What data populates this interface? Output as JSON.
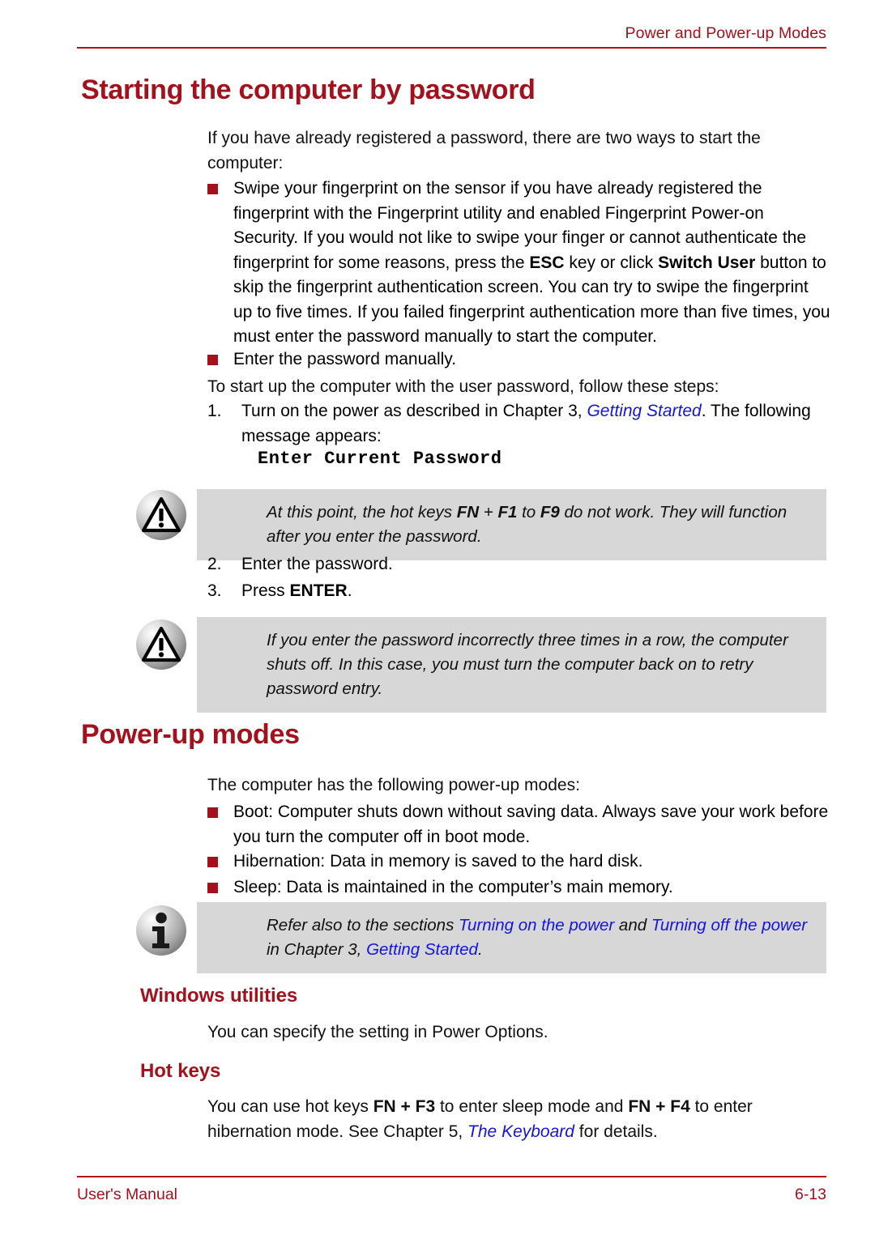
{
  "page": {
    "header_title": "Power and Power-up Modes",
    "footer_left": "User's Manual",
    "footer_right": "6-13",
    "accent_red": "#A4101B",
    "link_blue": "#1414E0",
    "note_bg": "#D7D7D7"
  },
  "sections": {
    "starting": {
      "heading": "Starting the computer by password",
      "intro": "If you have already registered a password, there are two ways to start the computer:",
      "bullets": [
        {
          "parts": [
            {
              "t": "Swipe your fingerprint on the sensor if you have already registered the fingerprint with the Fingerprint utility and enabled Fingerprint Power-on Security. If you would not like to swipe your finger or cannot authenticate the fingerprint for some reasons, press the ",
              "s": "normal"
            },
            {
              "t": "ESC",
              "s": "bold"
            },
            {
              "t": " key or click ",
              "s": "normal"
            },
            {
              "t": "Switch User",
              "s": "bold"
            },
            {
              "t": " button to skip the fingerprint authentication screen. You can try to swipe the fingerprint up to five times. If you failed fingerprint authentication more than five times, you must enter the password manually to start the computer.",
              "s": "normal"
            }
          ]
        },
        {
          "parts": [
            {
              "t": "Enter the password manually.",
              "s": "normal"
            }
          ]
        }
      ],
      "steps_intro": "To start up the computer with the user password, follow these steps:",
      "steps": [
        {
          "num": "1.",
          "parts": [
            {
              "t": "Turn on the power as described in Chapter 3, ",
              "s": "normal"
            },
            {
              "t": "Getting Started",
              "s": "link-italic"
            },
            {
              "t": ". The following message appears:",
              "s": "normal"
            }
          ]
        },
        {
          "num": "2.",
          "parts": [
            {
              "t": "Enter the password.",
              "s": "normal"
            }
          ]
        },
        {
          "num": "3.",
          "parts": [
            {
              "t": "Press ",
              "s": "normal"
            },
            {
              "t": "ENTER",
              "s": "bold"
            },
            {
              "t": ".",
              "s": "normal"
            }
          ]
        }
      ],
      "message_code": "Enter Current Password",
      "note_1": {
        "icon": "caution-icon",
        "parts": [
          {
            "t": "At this point, the hot keys ",
            "s": "italic"
          },
          {
            "t": "FN",
            "s": "bold-italic"
          },
          {
            "t": " + ",
            "s": "italic"
          },
          {
            "t": "F1",
            "s": "bold-italic"
          },
          {
            "t": " to ",
            "s": "italic"
          },
          {
            "t": "F9",
            "s": "bold-italic"
          },
          {
            "t": " do not work. They will function after you enter the password.",
            "s": "italic"
          }
        ]
      },
      "note_2": {
        "icon": "caution-icon",
        "parts": [
          {
            "t": "If you enter the password incorrectly three times in a row, the computer shuts off. In this case, you must turn the computer back on to retry password entry.",
            "s": "italic"
          }
        ]
      }
    },
    "powerup": {
      "heading": "Power-up modes",
      "intro": "The computer has the following power-up modes:",
      "bullets": [
        {
          "parts": [
            {
              "t": "Boot: Computer shuts down without saving data. Always save your work before you turn the computer off in boot mode.",
              "s": "normal"
            }
          ]
        },
        {
          "parts": [
            {
              "t": "Hibernation: Data in memory is saved to the hard disk.",
              "s": "normal"
            }
          ]
        },
        {
          "parts": [
            {
              "t": "Sleep: Data is maintained in the computer’s main memory.",
              "s": "normal"
            }
          ]
        }
      ],
      "note_3": {
        "icon": "info-icon",
        "parts": [
          {
            "t": "Refer also to the sections ",
            "s": "italic"
          },
          {
            "t": "Turning on the power",
            "s": "link-italic"
          },
          {
            "t": " and ",
            "s": "italic"
          },
          {
            "t": "Turning off the power",
            "s": "link-italic"
          },
          {
            "t": " in Chapter 3, ",
            "s": "italic"
          },
          {
            "t": "Getting Started",
            "s": "link-italic"
          },
          {
            "t": ".",
            "s": "italic"
          }
        ]
      },
      "windows_utilities": {
        "heading": "Windows utilities",
        "body": "You can specify the setting in Power Options."
      },
      "hot_keys": {
        "heading": "Hot keys",
        "parts": [
          {
            "t": "You can use hot keys ",
            "s": "normal"
          },
          {
            "t": "FN + F3",
            "s": "bold"
          },
          {
            "t": " to enter sleep mode and ",
            "s": "normal"
          },
          {
            "t": "FN + F4",
            "s": "bold"
          },
          {
            "t": " to enter hibernation mode. See Chapter 5, ",
            "s": "normal"
          },
          {
            "t": "The Keyboard",
            "s": "link-italic"
          },
          {
            "t": " for details.",
            "s": "normal"
          }
        ]
      }
    }
  }
}
